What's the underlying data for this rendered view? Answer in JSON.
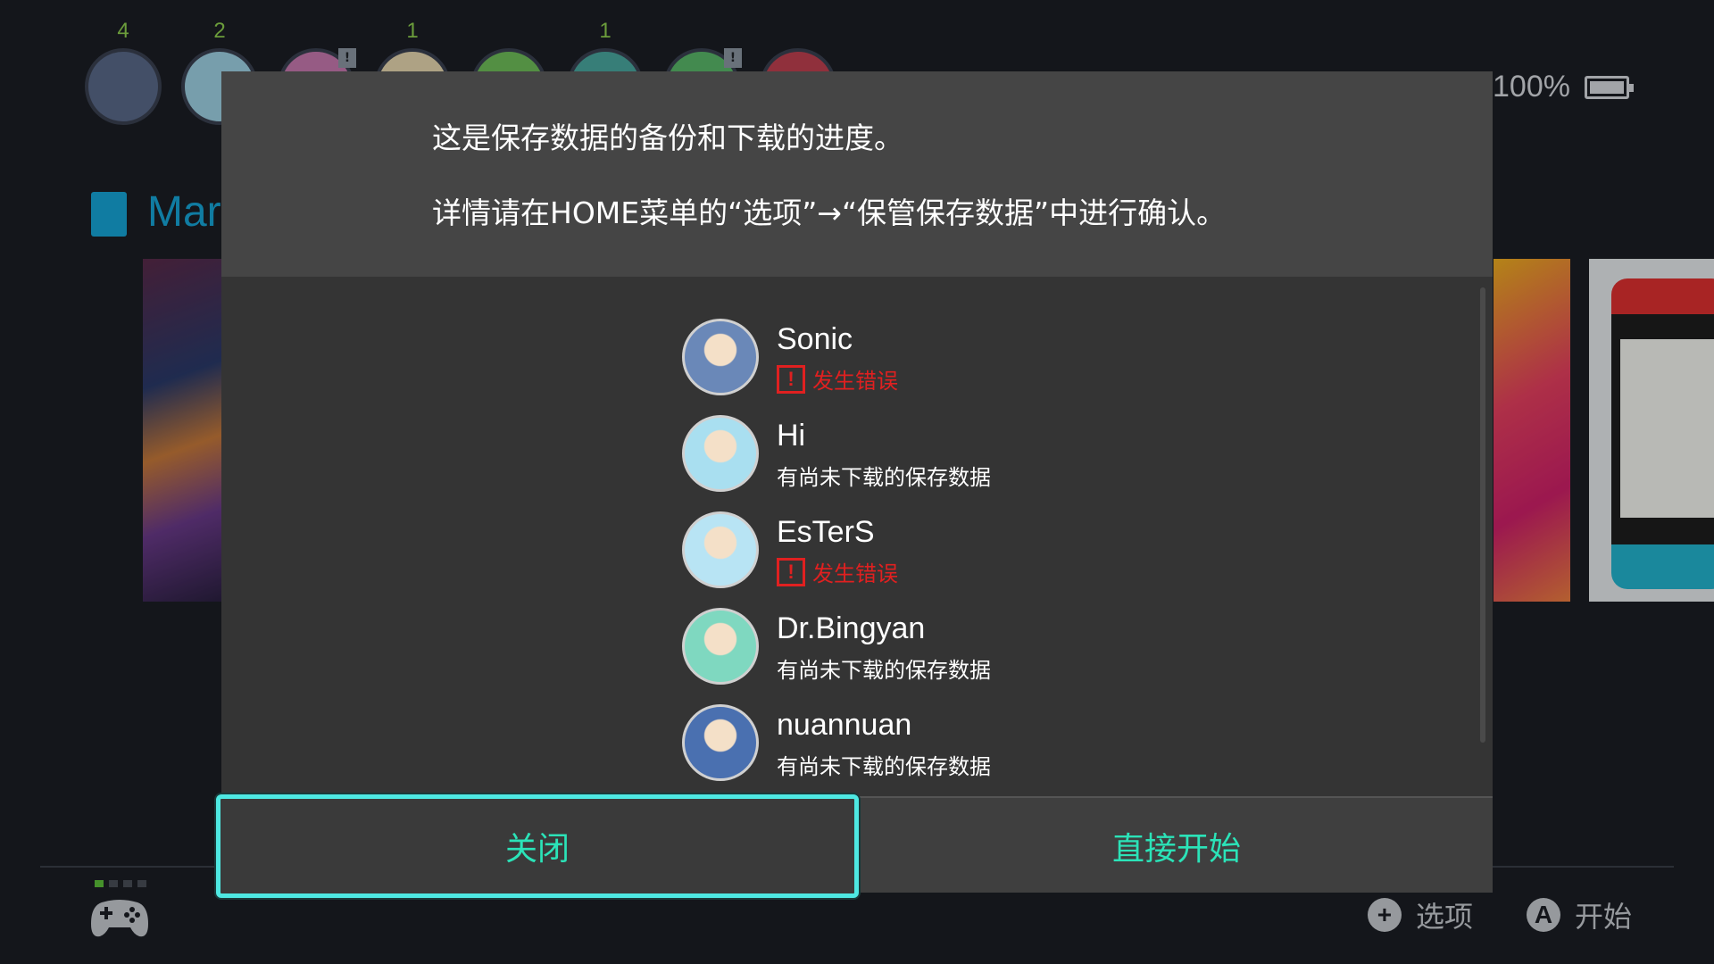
{
  "users_bar": [
    {
      "badge": "4",
      "color": "#5a6a8a",
      "alert": false
    },
    {
      "badge": "2",
      "color": "#9fd3e6",
      "alert": false
    },
    {
      "badge": "",
      "color": "#c97ab0",
      "alert": true
    },
    {
      "badge": "1",
      "color": "#e8d8b0",
      "alert": false
    },
    {
      "badge": "",
      "color": "#6fbf5a",
      "alert": false
    },
    {
      "badge": "1",
      "color": "#4aa8a0",
      "alert": false
    },
    {
      "badge": "",
      "color": "#5ab86a",
      "alert": true
    },
    {
      "badge": "",
      "color": "#c04050",
      "alert": false
    }
  ],
  "battery": {
    "percent": "100%"
  },
  "home": {
    "game_title_visible": "Mar"
  },
  "footer": {
    "options_glyph": "+",
    "options_label": "选项",
    "start_glyph": "A",
    "start_label": "开始"
  },
  "dialog": {
    "message_line1": "这是保存数据的备份和下载的进度。",
    "message_line2": "详情请在HOME菜单的“选项”→“保管保存数据”中进行确认。",
    "users": [
      {
        "name": "Sonic",
        "status": "发生错误",
        "error": true,
        "avatar_color": "#6a88b8"
      },
      {
        "name": "Hi",
        "status": "有尚未下载的保存数据",
        "error": false,
        "avatar_color": "#a9dff0"
      },
      {
        "name": "EsTerS",
        "status": "发生错误",
        "error": true,
        "avatar_color": "#b8e4f4"
      },
      {
        "name": "Dr.Bingyan",
        "status": "有尚未下载的保存数据",
        "error": false,
        "avatar_color": "#7fd8c0"
      },
      {
        "name": "nuannuan",
        "status": "有尚未下载的保存数据",
        "error": false,
        "avatar_color": "#4a70b0"
      }
    ],
    "error_glyph": "!",
    "close_label": "关闭",
    "start_label": "直接开始"
  },
  "colors": {
    "accent": "#2be3b8",
    "focus_border": "#4ee8e2",
    "error": "#e02020",
    "battery": "#d8dbe0"
  }
}
